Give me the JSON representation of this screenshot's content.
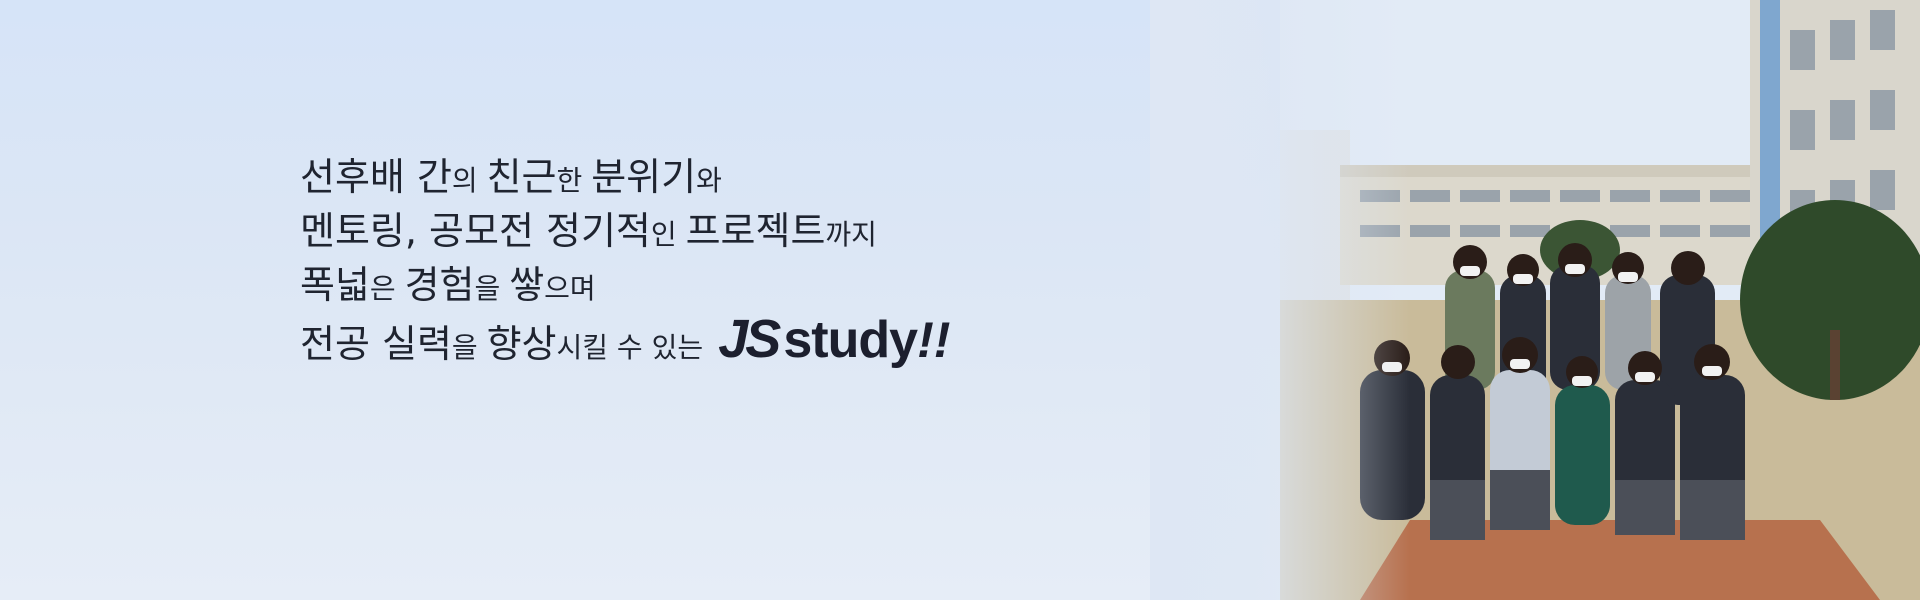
{
  "hero": {
    "lines": [
      [
        {
          "text": "선후배 간",
          "size": "big"
        },
        {
          "text": "의 ",
          "size": "small"
        },
        {
          "text": "친근",
          "size": "big"
        },
        {
          "text": "한 ",
          "size": "small"
        },
        {
          "text": "분위기",
          "size": "big"
        },
        {
          "text": "와",
          "size": "small"
        }
      ],
      [
        {
          "text": "멘토링, 공모전 정기적",
          "size": "big"
        },
        {
          "text": "인 ",
          "size": "small"
        },
        {
          "text": "프로젝트",
          "size": "big"
        },
        {
          "text": "까지",
          "size": "small"
        }
      ],
      [
        {
          "text": "폭넓",
          "size": "big"
        },
        {
          "text": "은 ",
          "size": "small"
        },
        {
          "text": "경험",
          "size": "big"
        },
        {
          "text": "을 ",
          "size": "small"
        },
        {
          "text": "쌓",
          "size": "big"
        },
        {
          "text": "으며",
          "size": "small"
        }
      ],
      [
        {
          "text": "전공 실력",
          "size": "big"
        },
        {
          "text": "을 ",
          "size": "small"
        },
        {
          "text": "향상",
          "size": "big"
        },
        {
          "text": "시킬 수 있는",
          "size": "small"
        }
      ]
    ],
    "brand": {
      "logo": "JS",
      "word": "study",
      "exclaim": "!!"
    },
    "colors": {
      "text": "#1f2430",
      "sky": "#d6e4f8",
      "building": "#dcd8cc",
      "tree": "#2f4a2a",
      "brick": "#b7714e",
      "uniform": "#2a2e38"
    }
  }
}
